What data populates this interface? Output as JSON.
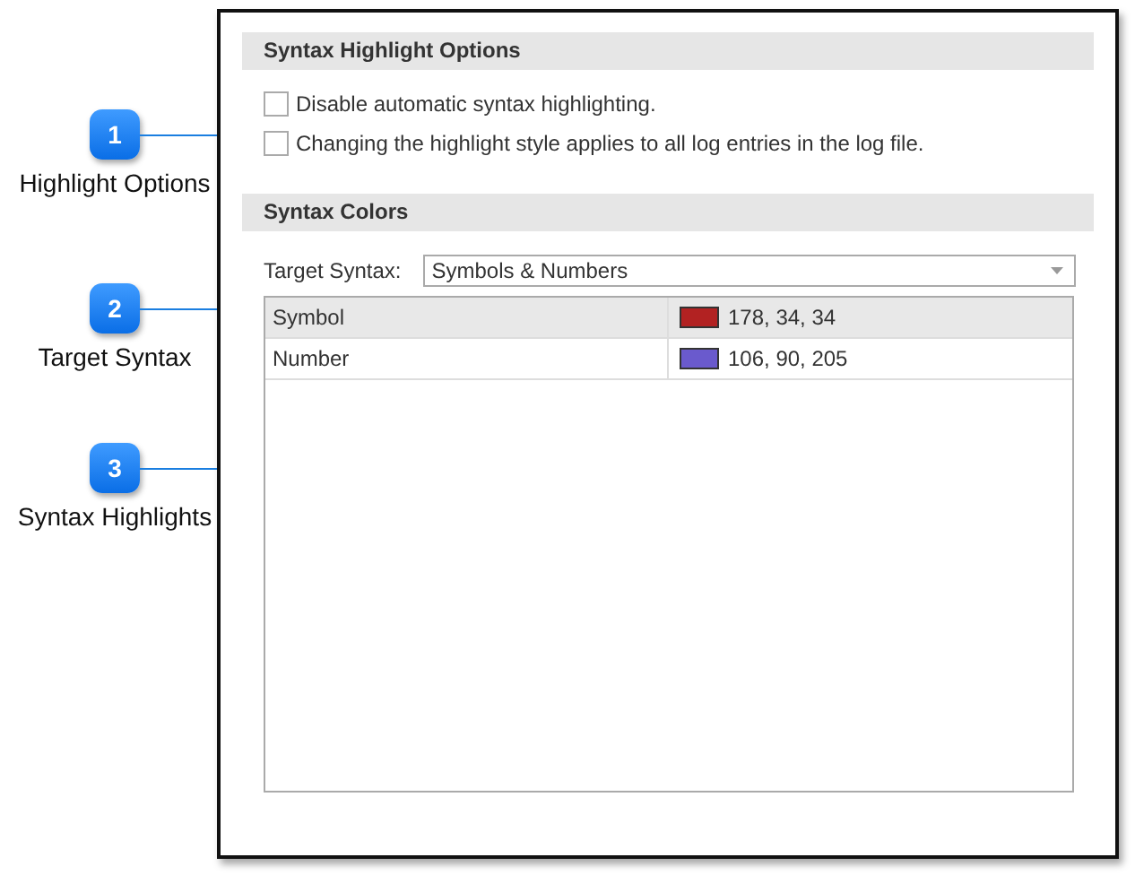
{
  "callouts": [
    {
      "number": "1",
      "label": "Highlight Options"
    },
    {
      "number": "2",
      "label": "Target Syntax"
    },
    {
      "number": "3",
      "label": "Syntax Highlights"
    }
  ],
  "options": {
    "title": "Syntax Highlight Options",
    "checkboxes": [
      {
        "label": "Disable automatic syntax highlighting.",
        "checked": false
      },
      {
        "label": "Changing the highlight style applies to all log entries in the log file.",
        "checked": false
      }
    ]
  },
  "colors": {
    "title": "Syntax Colors",
    "target_syntax": {
      "label": "Target Syntax:",
      "value": "Symbols & Numbers"
    },
    "rows": [
      {
        "name": "Symbol",
        "color": "#b22222",
        "value": "178, 34, 34",
        "selected": true
      },
      {
        "name": "Number",
        "color": "#6a5acd",
        "value": "106, 90, 205",
        "selected": false
      }
    ]
  }
}
